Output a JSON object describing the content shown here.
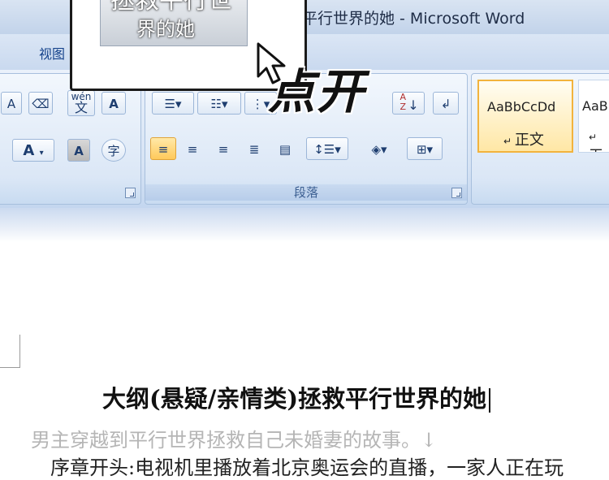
{
  "window": {
    "title": "平行世界的她 - Microsoft Word"
  },
  "ribbon": {
    "tabs": [
      {
        "label": "视图"
      }
    ],
    "font_group": {
      "grow_font": "A",
      "font_color": "A",
      "char_shading": "A",
      "char_border": "A",
      "phonetic_top": "wén",
      "phonetic_char": "文",
      "enclose_char": "字"
    },
    "paragraph_group": {
      "label": "段落",
      "sort_label": "A Z"
    },
    "styles": [
      {
        "sample": "AaBbCcDd",
        "name": "正文",
        "selected": true
      },
      {
        "sample": "AaBl",
        "name": "无",
        "selected": false
      }
    ]
  },
  "popup": {
    "text_top": "拯救平行世",
    "text_bottom": "界的她"
  },
  "annotation": {
    "text": "点开"
  },
  "document": {
    "title": "大纲(悬疑/亲情类)拯救平行世界的她",
    "line1": "男主穿越到平行世界拯救自己未婚妻的故事。↓",
    "line2": "序章开头:电视机里播放着北京奥运会的直播，一家人正在玩"
  },
  "colors": {
    "ribbon_blue": "#c9d9ef",
    "selected_gold": "#f2b33d",
    "text_dark": "#111111"
  }
}
